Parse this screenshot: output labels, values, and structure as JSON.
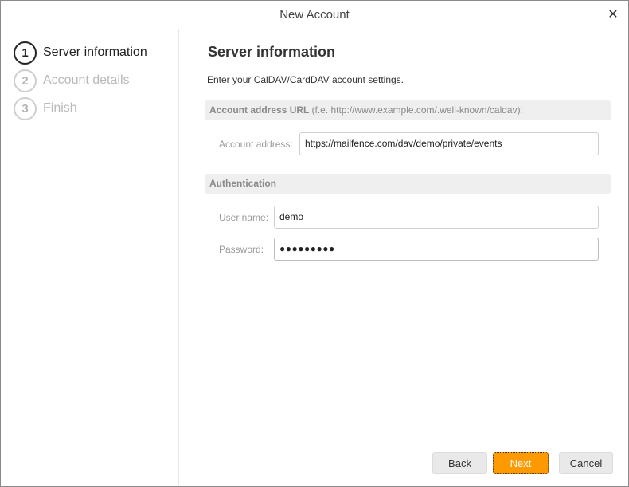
{
  "window": {
    "title": "New Account",
    "close_glyph": "✕"
  },
  "steps": [
    {
      "number": "1",
      "label": "Server information",
      "active": true
    },
    {
      "number": "2",
      "label": "Account details",
      "active": false
    },
    {
      "number": "3",
      "label": "Finish",
      "active": false
    }
  ],
  "main": {
    "heading": "Server information",
    "intro": "Enter your CalDAV/CardDAV account settings."
  },
  "url_section": {
    "title": "Account address URL",
    "hint": "(f.e. http://www.example.com/.well-known/caldav):",
    "address_label": "Account address:",
    "address_value": "https://mailfence.com/dav/demo/private/events"
  },
  "auth_section": {
    "title": "Authentication",
    "username_label": "User name:",
    "username_value": "demo",
    "password_label": "Password:",
    "password_mask": "●●●●●●●●●"
  },
  "buttons": {
    "back": "Back",
    "next": "Next",
    "cancel": "Cancel"
  },
  "colors": {
    "accent": "#ff9900",
    "section_bg": "#efefef"
  }
}
